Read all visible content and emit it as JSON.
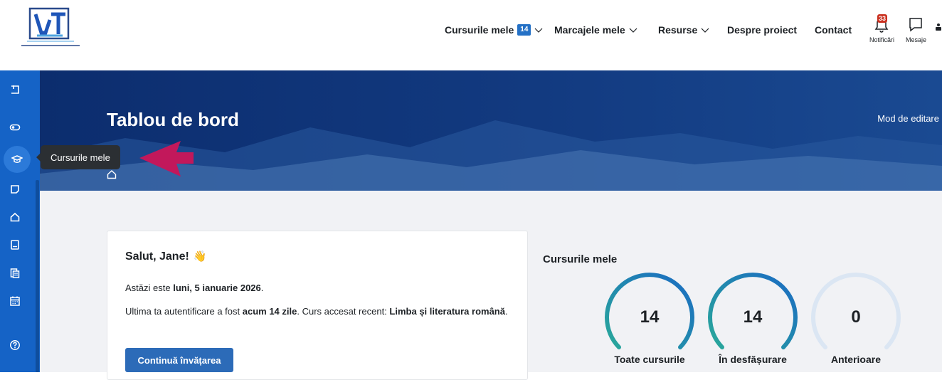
{
  "nav": {
    "my_courses": "Cursurile mele",
    "my_courses_count": "14",
    "bookmarks": "Marcajele mele",
    "resources": "Resurse",
    "about": "Despre proiect",
    "contact": "Contact",
    "notifications_label": "Notificări",
    "notifications_count": "33",
    "messages_label": "Mesaje"
  },
  "hero": {
    "title": "Tablou de bord",
    "edit_mode": "Mod de editare"
  },
  "tooltip": "Cursurile mele",
  "welcome": {
    "greeting": "Salut, Jane!",
    "today_prefix": "Astăzi este ",
    "today_date": "luni, 5 ianuarie 2026",
    "today_suffix": ".",
    "last_login_prefix": "Ultima ta autentificare a fost ",
    "last_login_ago": "acum 14 zile",
    "recent_prefix": ". Curs accesat recent: ",
    "recent_course": "Limba și literatura română",
    "recent_suffix": ".",
    "continue_button": "Continuă învățarea"
  },
  "courses": {
    "heading": "Cursurile mele",
    "stats": [
      {
        "label": "Toate cursurile",
        "value": "14"
      },
      {
        "label": "În desfășurare",
        "value": "14"
      },
      {
        "label": "Anterioare",
        "value": "0"
      }
    ]
  },
  "colors": {
    "primary": "#1563c6",
    "hero_dark": "#0c2d6e",
    "accent_pink": "#c2185b",
    "badge_red": "#ca3120",
    "button_blue": "#2c6bb8"
  },
  "rail_icons": [
    "collapse-drawer-icon",
    "toggle-icon",
    "graduation-cap-icon",
    "note-icon",
    "home-icon",
    "tablet-icon",
    "document-icon",
    "calendar-icon",
    "help-icon"
  ]
}
